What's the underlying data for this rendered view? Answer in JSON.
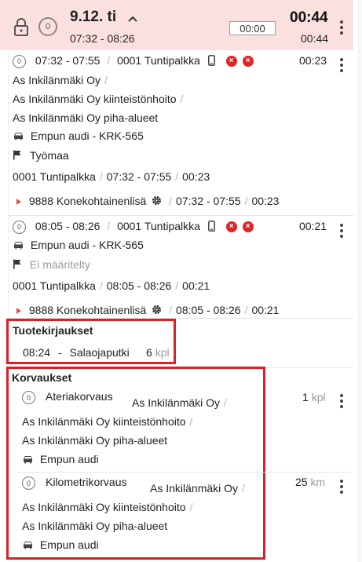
{
  "header": {
    "lock_icon": "lock-icon",
    "badge": "0",
    "date": "9.12. ti",
    "time_range": "07:32 - 08:26",
    "timer_value": "00:00",
    "total_big": "00:44",
    "total_small": "00:44",
    "bg_color": "#fbe0e0"
  },
  "entry1": {
    "badge": "0",
    "time_range": "07:32 - 07:55",
    "code": "0001 Tuntipalkka",
    "duration": "00:23",
    "line1": "As Inkilänmäki Oy",
    "line2": "As Inkilänmäki Oy kiinteistönhoito",
    "line3": "As Inkilänmäki Oy piha-alueet",
    "vehicle": "Empun audi - KRK-565",
    "flag": "Työmaa",
    "row_code": "0001 Tuntipalkka",
    "row_time": "07:32 - 07:55",
    "row_dur": "00:23",
    "sub_code": "9888 Konekohtainenlisä",
    "sub_time": "07:32 - 07:55",
    "sub_dur": "00:23"
  },
  "entry2": {
    "badge": "0",
    "time_range": "08:05 - 08:26",
    "code": "0001 Tuntipalkka",
    "duration": "00:21",
    "vehicle": "Empun audi - KRK-565",
    "flag": "Ei määritelty",
    "row_code": "0001 Tuntipalkka",
    "row_time": "08:05 - 08:26",
    "row_dur": "00:21",
    "sub_code": "9888 Konekohtainenlisä",
    "sub_time": "08:05 - 08:26",
    "sub_dur": "00:21"
  },
  "products": {
    "title": "Tuotekirjaukset",
    "time": "08:24",
    "dash": "-",
    "name": "Salaojaputki",
    "qty": "6",
    "unit": "kpl"
  },
  "compensations": {
    "title": "Korvaukset",
    "items": [
      {
        "badge": "0",
        "name": "Ateriakorvaus",
        "line1": "As Inkilänmäki Oy",
        "line2": "As Inkilänmäki Oy kiinteistönhoito",
        "line3": "As Inkilänmäki Oy piha-alueet",
        "vehicle": "Empun audi",
        "qty": "1",
        "unit": "kpl"
      },
      {
        "badge": "0",
        "name": "Kilometrikorvaus",
        "line1": "As Inkilänmäki Oy",
        "line2": "As Inkilänmäki Oy kiinteistönhoito",
        "line3": "As Inkilänmäki Oy piha-alueet",
        "vehicle": "Empun audi",
        "qty": "25",
        "unit": "km"
      }
    ]
  },
  "separator": "/",
  "colors": {
    "highlight_red": "#dd1f26",
    "error_red": "#e02424",
    "accent_triangle": "#d9534f"
  }
}
